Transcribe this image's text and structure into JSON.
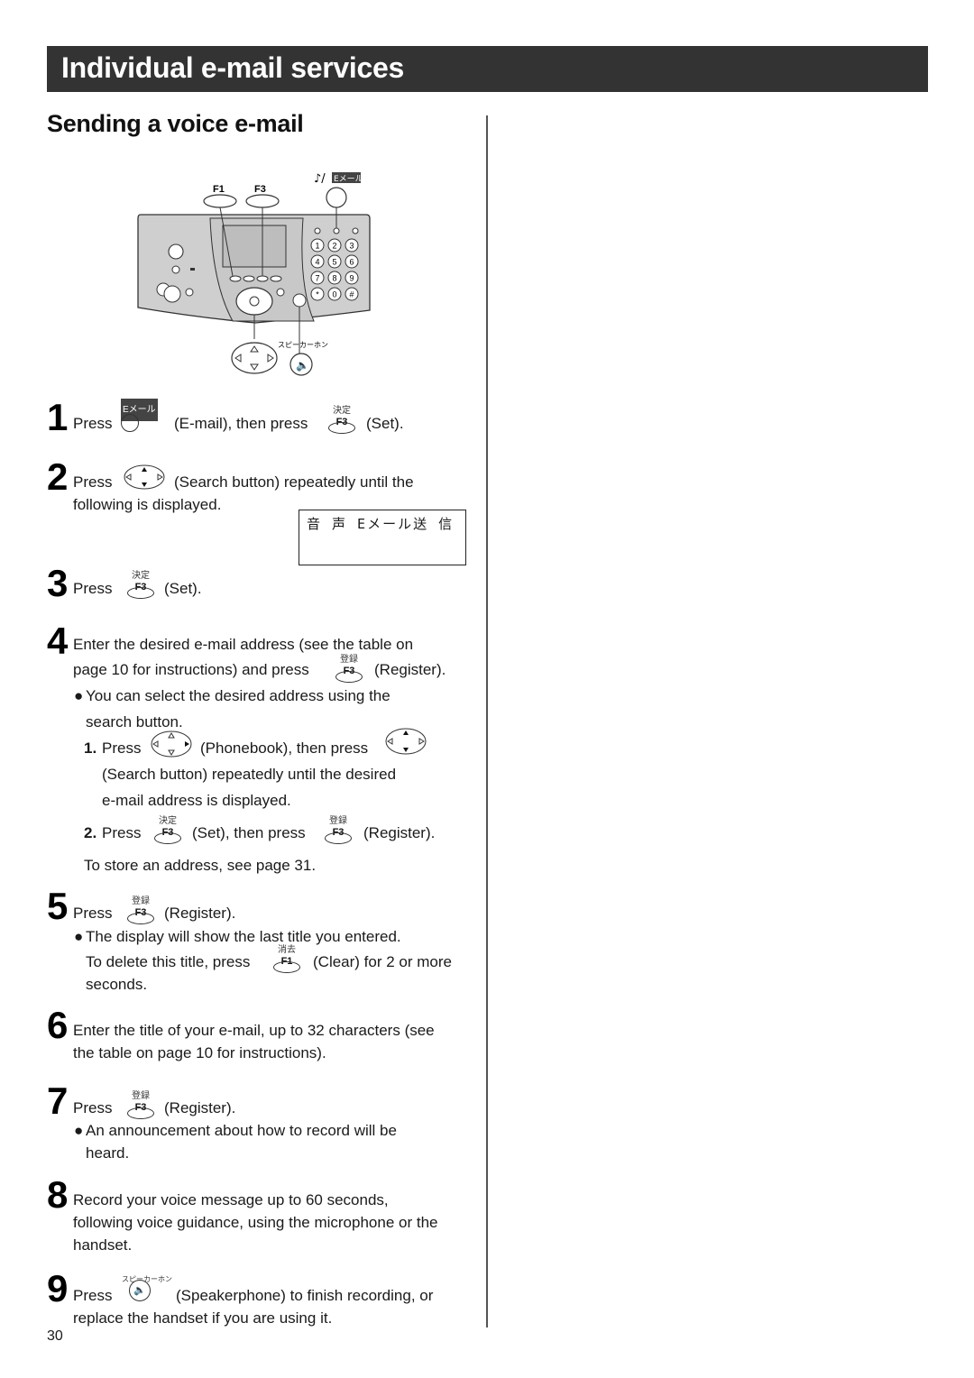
{
  "header": {
    "title": "Individual e-mail services"
  },
  "section": {
    "title": "Sending a voice e-mail"
  },
  "diagram": {
    "f1_label": "F1",
    "f3_label": "F3",
    "email_key_label": "Eメール",
    "speakerphone_label": "スピーカーホン",
    "keypad": [
      "1",
      "2",
      "3",
      "4",
      "5",
      "6",
      "7",
      "8",
      "9",
      "*",
      "0",
      "#"
    ]
  },
  "steps": [
    {
      "number": "1",
      "press": "Press",
      "key1_top": "Eメール",
      "mid": "(E-mail), then press",
      "key2_jp": "決定",
      "key2_label": "F3",
      "end": "(Set)."
    },
    {
      "number": "2",
      "press": "Press",
      "rest": "(Search button) repeatedly until the",
      "line2": "following is displayed."
    },
    {
      "number": "3",
      "press": "Press",
      "key_jp": "決定",
      "key_label": "F3",
      "end": "(Set)."
    },
    {
      "number": "4",
      "line1": "Enter the desired e-mail address (see the table on",
      "line2_pre": "page 10 for instructions) and press",
      "key_jp": "登録",
      "key_label": "F3",
      "line2_end": "(Register).",
      "bullet": "You can select the desired address using the",
      "bullet_cont": "search button.",
      "sub1_num": "1.",
      "sub1_press": "Press",
      "sub1_mid": "(Phonebook), then press",
      "sub1_line2": "(Search button) repeatedly until the desired",
      "sub1_line3": "e-mail address is displayed.",
      "sub2_num": "2.",
      "sub2_press": "Press",
      "sub2_key1_jp": "決定",
      "sub2_key1_label": "F3",
      "sub2_mid": "(Set), then press",
      "sub2_key2_jp": "登録",
      "sub2_key2_label": "F3",
      "sub2_end": "(Register).",
      "note": "To store an address, see page 31."
    },
    {
      "number": "5",
      "press": "Press",
      "key_jp": "登録",
      "key_label": "F3",
      "end": "(Register).",
      "bullet": "The display will show the last title you entered.",
      "line2_pre": "To delete this title, press",
      "key2_jp": "消去",
      "key2_label": "F1",
      "line2_end": "(Clear) for 2 or more",
      "line3": "seconds."
    },
    {
      "number": "6",
      "line1": "Enter the title of your e-mail, up to 32 characters (see",
      "line2": "the table on page 10 for instructions)."
    },
    {
      "number": "7",
      "press": "Press",
      "key_jp": "登録",
      "key_label": "F3",
      "end": "(Register).",
      "bullet": "An announcement about how to record will be",
      "bullet_cont": "heard."
    },
    {
      "number": "8",
      "line1": "Record your voice message up to 60 seconds,",
      "line2": "following voice guidance, using the microphone or the",
      "line3": "handset."
    },
    {
      "number": "9",
      "press": "Press",
      "key_jp": "スピーカーホン",
      "end": "(Speakerphone) to finish recording, or",
      "line2": "replace the handset if you are using it."
    }
  ],
  "display": {
    "text": "音 声 Eメール送 信"
  },
  "footer": {
    "page_number": "30"
  }
}
